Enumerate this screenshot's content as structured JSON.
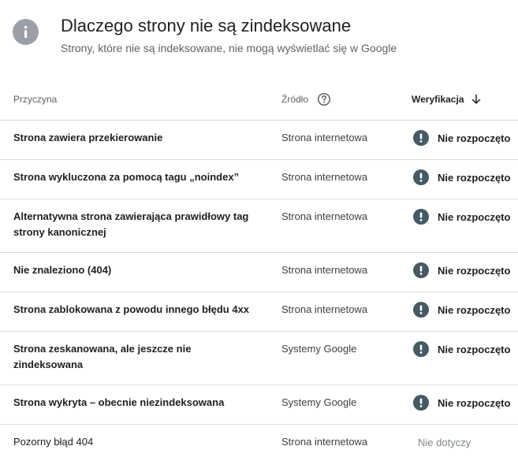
{
  "header": {
    "title": "Dlaczego strony nie są zindeksowane",
    "subtitle": "Strony, które nie są indeksowane, nie mogą wyświetlać się w Google",
    "icon": "info-icon"
  },
  "table": {
    "columns": {
      "reason": "Przyczyna",
      "source": "Źródło",
      "verification": "Weryfikacja"
    },
    "rows": [
      {
        "reason": "Strona zawiera przekierowanie",
        "source": "Strona internetowa",
        "verification": "Nie rozpoczęto"
      },
      {
        "reason": "Strona wykluczona za pomocą tagu „noindex”",
        "source": "Strona internetowa",
        "verification": "Nie rozpoczęto"
      },
      {
        "reason": "Alternatywna strona zawierająca prawidłowy tag strony kanonicznej",
        "source": "Strona internetowa",
        "verification": "Nie rozpoczęto"
      },
      {
        "reason": "Nie znaleziono (404)",
        "source": "Strona internetowa",
        "verification": "Nie rozpoczęto"
      },
      {
        "reason": "Strona zablokowana z powodu innego błędu 4xx",
        "source": "Strona internetowa",
        "verification": "Nie rozpoczęto"
      },
      {
        "reason": "Strona zeskanowana, ale jeszcze nie zindeksowana",
        "source": "Systemy Google",
        "verification": "Nie rozpoczęto"
      },
      {
        "reason": "Strona wykryta – obecnie niezindeksowana",
        "source": "Systemy Google",
        "verification": "Nie rozpoczęto"
      },
      {
        "reason": "Pozorny błąd 404",
        "source": "Strona internetowa",
        "verification": "Nie dotyczy"
      }
    ]
  },
  "colors": {
    "status_icon": "#455a64",
    "info_icon_bg": "#9aa0a6",
    "divider": "#dadce0"
  }
}
